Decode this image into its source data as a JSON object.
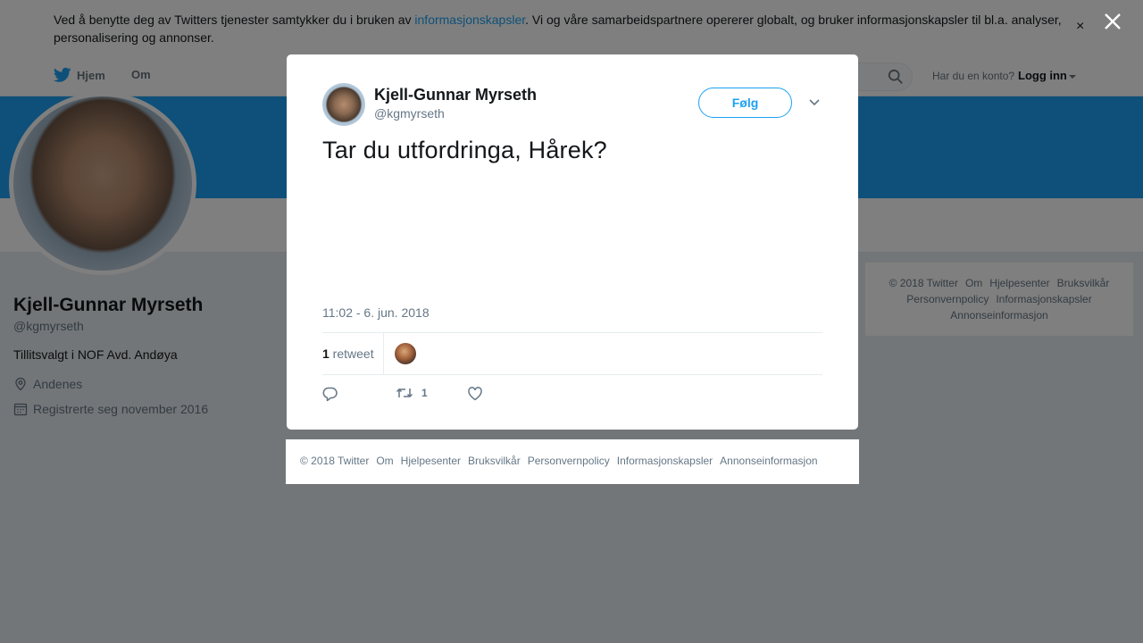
{
  "cookie_banner": {
    "text_before": "Ved å benytte deg av Twitters tjenester samtykker du i bruken av ",
    "link": "informasjonskapsler",
    "text_after": ". Vi og våre samarbeidspartnere opererer globalt, og bruker informasjonskapsler til bl.a. analyser, personalisering og annonser.",
    "close": "×"
  },
  "nav": {
    "home": "Hjem",
    "about": "Om",
    "login_question": "Har du en konto?",
    "login": "Logg inn"
  },
  "profile": {
    "name": "Kjell-Gunnar Myrseth",
    "handle": "@kgmyrseth",
    "bio": "Tillitsvalgt i NOF Avd. Andøya",
    "location": "Andenes",
    "joined": "Registrerte seg november 2016"
  },
  "side_footer": {
    "links": [
      "© 2018 Twitter",
      "Om",
      "Hjelpesenter",
      "Bruksvilkår",
      "Personvernpolicy",
      "Informasjonskapsler",
      "Annonseinformasjon"
    ]
  },
  "tweet": {
    "author_name": "Kjell-Gunnar Myrseth",
    "author_handle": "@kgmyrseth",
    "follow_label": "Følg",
    "text": "Tar du utfordringa, Hårek?",
    "timestamp": "11:02 - 6. jun. 2018",
    "retweet_count": "1",
    "retweet_label": " retweet",
    "retweet_action_count": "1"
  },
  "modal_footer": {
    "links": [
      "© 2018 Twitter",
      "Om",
      "Hjelpesenter",
      "Bruksvilkår",
      "Personvernpolicy",
      "Informasjonskapsler",
      "Annonseinformasjon"
    ]
  },
  "colors": {
    "brand": "#1da1f2",
    "overlay": "rgba(0,0,0,0.5)",
    "muted": "#657786"
  },
  "icons": [
    "twitter-bird-icon",
    "search-icon",
    "location-pin-icon",
    "calendar-icon",
    "chevron-down-icon",
    "reply-icon",
    "retweet-icon",
    "like-heart-icon",
    "close-icon"
  ]
}
